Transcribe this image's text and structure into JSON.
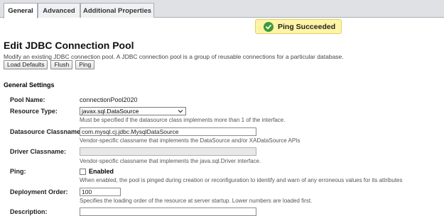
{
  "tabs": [
    {
      "label": "General",
      "active": true
    },
    {
      "label": "Advanced",
      "active": false
    },
    {
      "label": "Additional Properties",
      "active": false
    }
  ],
  "banner": {
    "text": "Ping Succeeded",
    "icon": "check-circle-icon",
    "color": "#fdf4a5"
  },
  "page": {
    "title": "Edit JDBC Connection Pool",
    "description": "Modify an existing JDBC connection pool. A JDBC connection pool is a group of reusable connections for a particular database."
  },
  "buttons": {
    "load_defaults": "Load Defaults",
    "flush": "Flush",
    "ping": "Ping"
  },
  "section": {
    "title": "General Settings"
  },
  "fields": {
    "pool_name": {
      "label": "Pool Name:",
      "value": "connectionPool2020"
    },
    "resource_type": {
      "label": "Resource Type:",
      "value": "javax.sql.DataSource",
      "help": "Must be specified if the datasource class implements more than 1 of the interface."
    },
    "datasource_classname": {
      "label": "Datasource Classname:",
      "value": "com.mysql.cj.jdbc.MysqlDataSource",
      "help": "Vendor-specific classname that implements the DataSource and/or XADataSource APIs"
    },
    "driver_classname": {
      "label": "Driver Classname:",
      "value": "",
      "help": "Vendor-specific classname that implements the java.sql.Driver interface."
    },
    "ping": {
      "label": "Ping:",
      "checkbox_label": "Enabled",
      "checked": false,
      "help": "When enabled, the pool is pinged during creation or reconfiguration to identify and warn of any erroneous values for its attributes"
    },
    "deployment_order": {
      "label": "Deployment Order:",
      "value": "100",
      "help": "Specifies the loading order of the resource at server startup. Lower numbers are loaded first."
    },
    "description": {
      "label": "Description:",
      "value": ""
    }
  }
}
